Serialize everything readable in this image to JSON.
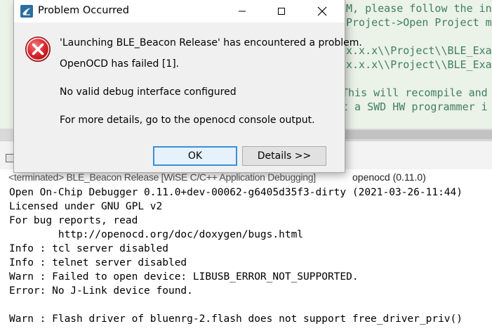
{
  "editor": {
    "lines": [
      "M, please follow the ins",
      "Project->Open Project m",
      "x.x.x\\\\Project\\\\BLE_Exa",
      "x.x.x\\\\Project\\\\BLE_Exa",
      "This will recompile and",
      "t a SWD HW programmer i"
    ]
  },
  "console": {
    "status_left": "<terminated> BLE_Beacon Release [WiSE C/C++ Application Debugging]",
    "status_right": "openocd (0.11.0)",
    "lines": [
      "Open On-Chip Debugger 0.11.0+dev-00062-g6405d35f3-dirty (2021-03-26-11:44)",
      "Licensed under GNU GPL v2",
      "For bug reports, read",
      "        http://openocd.org/doc/doxygen/bugs.html",
      "Info : tcl server disabled",
      "Info : telnet server disabled",
      "Warn : Failed to open device: LIBUSB_ERROR_NOT_SUPPORTED.",
      "Error: No J-Link device found.",
      "",
      "Warn : Flash driver of bluenrg-2.flash does not support free_driver_priv()"
    ]
  },
  "dialog": {
    "title": "Problem Occurred",
    "icon": "error-icon",
    "message": "'Launching BLE_Beacon Release' has encountered a problem.",
    "detail1": "OpenOCD has failed [1].",
    "detail2": "No valid debug interface configured",
    "detail3": "For more details, go to the openocd console output.",
    "ok_label": "OK",
    "details_label": "Details >>"
  },
  "colors": {
    "editor_bg": "#ebf2e8",
    "comment_text": "#3f7f5f",
    "error_red": "#d9262c",
    "focus_blue": "#3b8fd8"
  }
}
